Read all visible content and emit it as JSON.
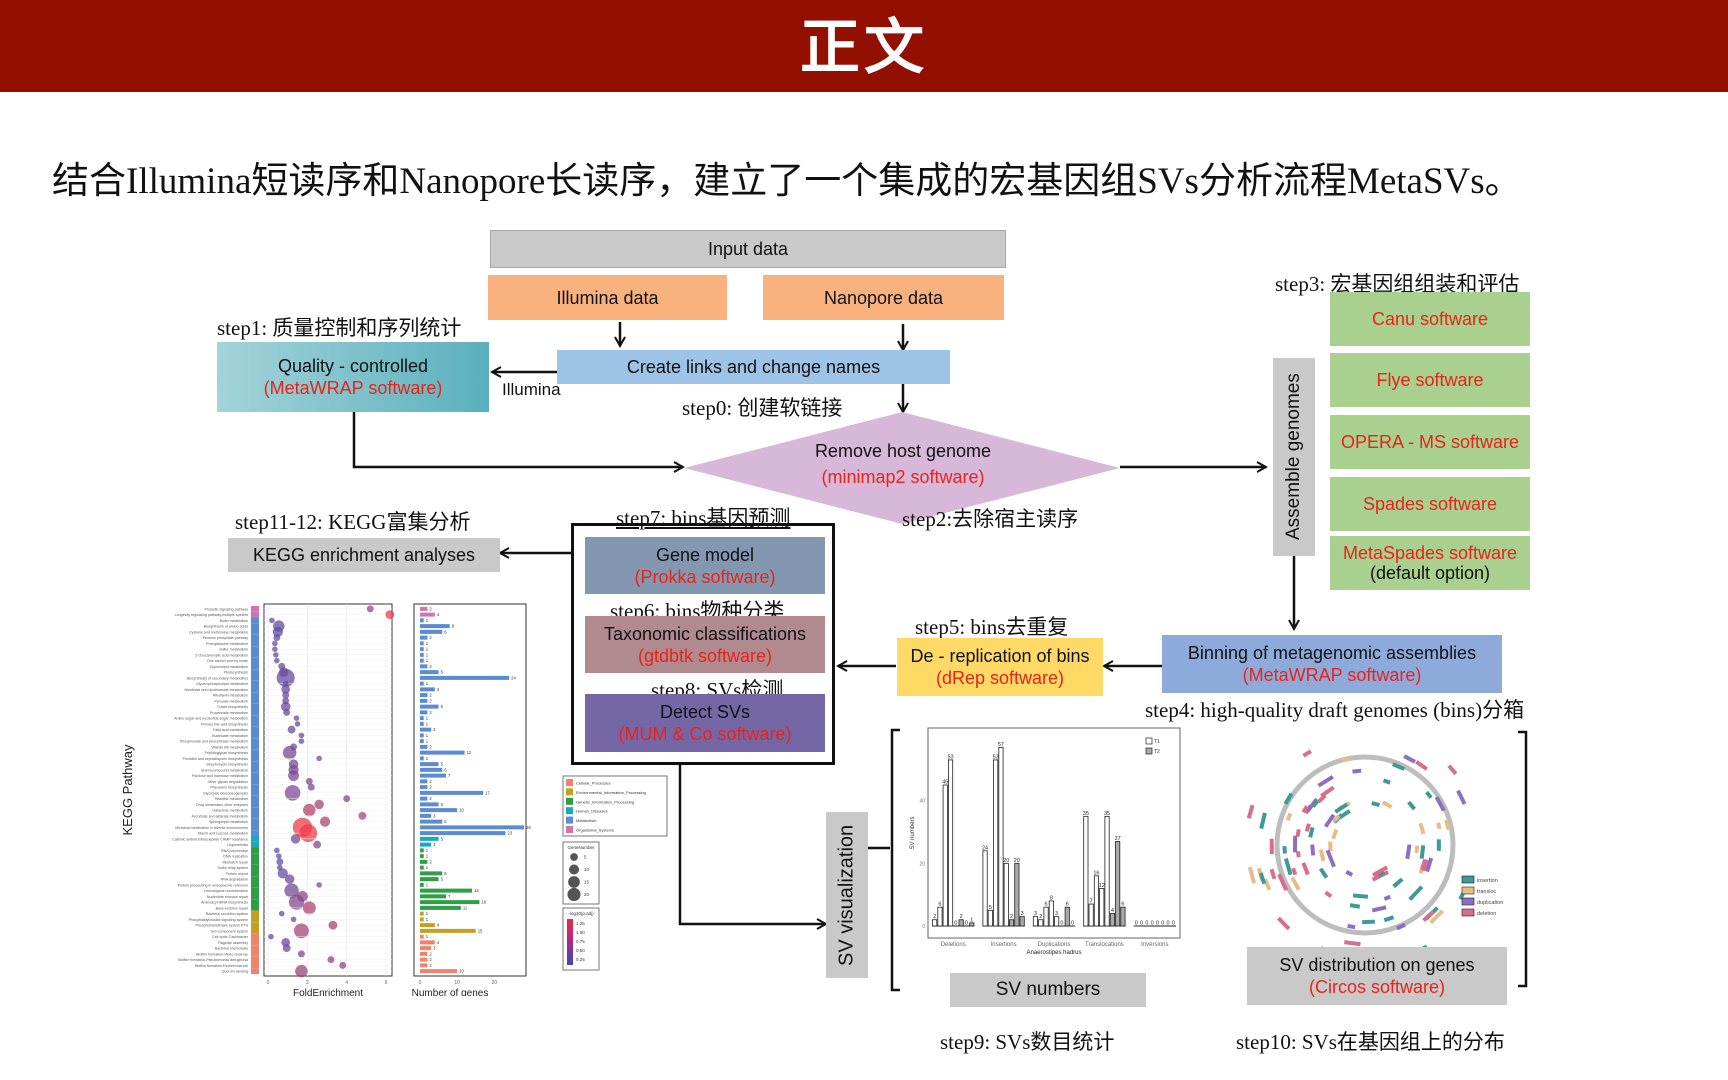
{
  "header": {
    "title": "正文"
  },
  "subtitle": "结合Illumina短读序和Nanopore长读序，建立了一个集成的宏基因组SVs分析流程MetaSVs。",
  "flow": {
    "input_data": "Input data",
    "illumina_data": "Illumina data",
    "nanopore_data": "Nanopore data",
    "create_links": "Create links and change names",
    "step0": "step0: 创建软链接",
    "illumina_label": "Illumina",
    "step1": "step1: 质量控制和序列统计",
    "quality": {
      "title": "Quality - controlled",
      "software": "(MetaWRAP software)"
    },
    "remove_host": {
      "title": "Remove host genome",
      "software": "(minimap2 software)"
    },
    "step2": "step2:去除宿主读序",
    "step3": "step3: 宏基因组组装和评估",
    "assemble": "Assemble genomes",
    "assemblers": [
      {
        "name": "Canu software",
        "note": ""
      },
      {
        "name": "Flye software",
        "note": ""
      },
      {
        "name": "OPERA - MS software",
        "note": ""
      },
      {
        "name": "Spades software",
        "note": ""
      },
      {
        "name": "MetaSpades software",
        "note": "(default option)"
      }
    ],
    "binning": {
      "title": "Binning of metagenomic assemblies",
      "software": "(MetaWRAP software)"
    },
    "step4": "step4: high-quality draft genomes (bins)分箱",
    "step5": "step5: bins去重复",
    "dereplication": {
      "title": "De - replication of bins",
      "software": "(dRep software)"
    },
    "step7": "step7: bins基因预测",
    "gene_model": {
      "title": "Gene model",
      "software": "(Prokka software)"
    },
    "step6": "step6: bins物种分类",
    "taxonomy": {
      "title": "Taxonomic classifications",
      "software": "(gtdbtk software)"
    },
    "step8": "step8: SVs检测",
    "detect_svs": {
      "title": "Detect SVs",
      "software": "(MUM & Co software)"
    },
    "step11_12": "step11-12: KEGG富集分析",
    "kegg_box": "KEGG enrichment analyses",
    "sv_visualization": "SV visualization",
    "sv_numbers_box": "SV numbers",
    "step9": "step9: SVs数目统计",
    "sv_distribution": {
      "title": "SV distribution on genes",
      "software": "(Circos software)"
    },
    "step10": "step10: SVs在基因组上的分布"
  },
  "colors": {
    "header_bg": "#930f00",
    "software_red": "#e8231b"
  },
  "chart_data": [
    {
      "type": "bar",
      "title": "",
      "xlabel": "Anaerostipes hadrus",
      "ylabel": "SV numbers",
      "ylim": [
        0,
        60
      ],
      "yticks": [
        0,
        20,
        40
      ],
      "categories": [
        "Deletions",
        "Insertions",
        "Duplications",
        "Translocations",
        "Inversions"
      ],
      "legend": {
        "entries": [
          "T1",
          "T2"
        ],
        "position": "top-right"
      },
      "groups": [
        {
          "category": "Deletions",
          "bars": [
            {
              "v": 2,
              "s": "T1"
            },
            {
              "v": 6,
              "s": "T1"
            },
            {
              "v": 45,
              "s": "T1"
            },
            {
              "v": 53,
              "s": "T1"
            },
            {
              "v": 0,
              "s": "T1"
            },
            {
              "v": 2,
              "s": "T2"
            },
            {
              "v": 0,
              "s": "T2"
            },
            {
              "v": 1,
              "s": "T2"
            }
          ]
        },
        {
          "category": "Insertions",
          "bars": [
            {
              "v": 24,
              "s": "T1"
            },
            {
              "v": 5,
              "s": "T1"
            },
            {
              "v": 53,
              "s": "T1"
            },
            {
              "v": 57,
              "s": "T1"
            },
            {
              "v": 20,
              "s": "T1"
            },
            {
              "v": 2,
              "s": "T2"
            },
            {
              "v": 20,
              "s": "T2"
            },
            {
              "v": 3,
              "s": "T2"
            }
          ]
        },
        {
          "category": "Duplications",
          "bars": [
            {
              "v": 3,
              "s": "T1"
            },
            {
              "v": 2,
              "s": "T1"
            },
            {
              "v": 6,
              "s": "T1"
            },
            {
              "v": 8,
              "s": "T1"
            },
            {
              "v": 3,
              "s": "T1"
            },
            {
              "v": 0,
              "s": "T2"
            },
            {
              "v": 6,
              "s": "T2"
            },
            {
              "v": 0,
              "s": "T2"
            }
          ]
        },
        {
          "category": "Translocations",
          "bars": [
            {
              "v": 35,
              "s": "T1"
            },
            {
              "v": 7,
              "s": "T1"
            },
            {
              "v": 16,
              "s": "T1"
            },
            {
              "v": 12,
              "s": "T1"
            },
            {
              "v": 35,
              "s": "T1"
            },
            {
              "v": 4,
              "s": "T2"
            },
            {
              "v": 27,
              "s": "T2"
            },
            {
              "v": 6,
              "s": "T2"
            }
          ]
        },
        {
          "category": "Inversions",
          "bars": [
            {
              "v": 0,
              "s": "T1"
            },
            {
              "v": 0,
              "s": "T1"
            },
            {
              "v": 0,
              "s": "T1"
            },
            {
              "v": 0,
              "s": "T1"
            },
            {
              "v": 0,
              "s": "T1"
            },
            {
              "v": 0,
              "s": "T2"
            },
            {
              "v": 0,
              "s": "T2"
            },
            {
              "v": 0,
              "s": "T2"
            }
          ]
        }
      ]
    },
    {
      "type": "scatter",
      "title": "",
      "ylabel": "KEGG Pathway",
      "xlabel": "FoldEnrichment",
      "xlim": [
        0,
        6
      ],
      "xticks": [
        0,
        2,
        4,
        6
      ],
      "bar_xlabel": "Number of genes",
      "bar_xticks": [
        0,
        10,
        20
      ],
      "bar_xlim": [
        0,
        28
      ],
      "class_legend": [
        {
          "name": "Cellular_Processes",
          "color": "#f0816a"
        },
        {
          "name": "Environmental_Information_Processing",
          "color": "#c4a021"
        },
        {
          "name": "Genetic_Information_Processing",
          "color": "#2e9e47"
        },
        {
          "name": "Human_Diseases",
          "color": "#1ca7bd"
        },
        {
          "name": "Metabolism",
          "color": "#5b8bd0"
        },
        {
          "name": "Organismal_Systems",
          "color": "#d074b0"
        }
      ],
      "size_legend": {
        "title": "GeneNumber",
        "values": [
          5,
          10,
          15,
          20
        ]
      },
      "color_legend": {
        "title": "-log10(p.adj)",
        "values": [
          1.25,
          1.0,
          0.75,
          0.5,
          0.25
        ]
      },
      "pathways": [
        {
          "name": "Prolactin signaling pathway",
          "cls": "Organismal_Systems",
          "fe": 5.2,
          "n": 2,
          "p": 0.6
        },
        {
          "name": "Longevity regulating pathway-multiple species",
          "cls": "Organismal_Systems",
          "fe": 6.2,
          "n": 4,
          "p": 1.2
        },
        {
          "name": "Biotin metabolism",
          "cls": "Metabolism",
          "fe": 0.2,
          "n": 1,
          "p": 0.2
        },
        {
          "name": "Biosynthesis of amino acids",
          "cls": "Metabolism",
          "fe": 0.55,
          "n": 8,
          "p": 0.2
        },
        {
          "name": "Cysteine and methionine metabolism",
          "cls": "Metabolism",
          "fe": 0.5,
          "n": 6,
          "p": 0.2
        },
        {
          "name": "Pentose phosphate pathway",
          "cls": "Metabolism",
          "fe": 0.45,
          "n": 2,
          "p": 0.2
        },
        {
          "name": "Phenylalanine metabolism",
          "cls": "Metabolism",
          "fe": 0.35,
          "n": 1,
          "p": 0.2
        },
        {
          "name": "Sulfur metabolism",
          "cls": "Metabolism",
          "fe": 0.35,
          "n": 1,
          "p": 0.2
        },
        {
          "name": "2-Oxocarboxylic acid metabolism",
          "cls": "Metabolism",
          "fe": 0.4,
          "n": 1,
          "p": 0.2
        },
        {
          "name": "One carbon pool by folate",
          "cls": "Metabolism",
          "fe": 0.45,
          "n": 1,
          "p": 0.2
        },
        {
          "name": "Glycerolipid metabolism",
          "cls": "Metabolism",
          "fe": 0.7,
          "n": 2,
          "p": 0.2
        },
        {
          "name": "Photosynthesis",
          "cls": "Metabolism",
          "fe": 0.8,
          "n": 5,
          "p": 0.2
        },
        {
          "name": "Biosynthesis of secondary metabolites",
          "cls": "Metabolism",
          "fe": 0.9,
          "n": 24,
          "p": 0.25
        },
        {
          "name": "Glycerophospholipid metabolism",
          "cls": "Metabolism",
          "fe": 0.9,
          "n": 1,
          "p": 0.2
        },
        {
          "name": "Nicotinate and nicotinamide metabolism",
          "cls": "Metabolism",
          "fe": 0.9,
          "n": 4,
          "p": 0.25
        },
        {
          "name": "Riboflavin metabolism",
          "cls": "Metabolism",
          "fe": 0.9,
          "n": 2,
          "p": 0.25
        },
        {
          "name": "Pyruvate metabolism",
          "cls": "Metabolism",
          "fe": 0.9,
          "n": 2,
          "p": 0.25
        },
        {
          "name": "Folate biosynthesis",
          "cls": "Metabolism",
          "fe": 0.9,
          "n": 5,
          "p": 0.25
        },
        {
          "name": "Propanoate metabolism",
          "cls": "Metabolism",
          "fe": 0.95,
          "n": 2,
          "p": 0.25
        },
        {
          "name": "Amino sugar and nucleotide sugar metabolism",
          "cls": "Metabolism",
          "fe": 1.45,
          "n": 1,
          "p": 0.3
        },
        {
          "name": "Primary bile acid biosynthesis",
          "cls": "Metabolism",
          "fe": 1.5,
          "n": 1,
          "p": 0.3
        },
        {
          "name": "Fatty acid metabolism",
          "cls": "Metabolism",
          "fe": 1.2,
          "n": 3,
          "p": 0.3
        },
        {
          "name": "Butanoate metabolism",
          "cls": "Metabolism",
          "fe": 1.7,
          "n": 1,
          "p": 0.3
        },
        {
          "name": "Phosphonate and phosphinate metabolism",
          "cls": "Metabolism",
          "fe": 1.7,
          "n": 1,
          "p": 0.3
        },
        {
          "name": "Vitamin B6 metabolism",
          "cls": "Metabolism",
          "fe": 1.3,
          "n": 2,
          "p": 0.3
        },
        {
          "name": "Peptidoglycan biosynthesis",
          "cls": "Metabolism",
          "fe": 1.1,
          "n": 12,
          "p": 0.35
        },
        {
          "name": "Penicillin and cephalosporin biosynthesis",
          "cls": "Metabolism",
          "fe": 2.6,
          "n": 1,
          "p": 0.4
        },
        {
          "name": "Streptomycin biosynthesis",
          "cls": "Metabolism",
          "fe": 1.3,
          "n": 5,
          "p": 0.35
        },
        {
          "name": "Selenocompound metabolism",
          "cls": "Metabolism",
          "fe": 1.3,
          "n": 6,
          "p": 0.35
        },
        {
          "name": "Fructose and mannose metabolism",
          "cls": "Metabolism",
          "fe": 1.3,
          "n": 7,
          "p": 0.35
        },
        {
          "name": "Other glycan degradation",
          "cls": "Metabolism",
          "fe": 2.1,
          "n": 2,
          "p": 0.4
        },
        {
          "name": "Phenazine biosynthesis",
          "cls": "Metabolism",
          "fe": 2.2,
          "n": 2,
          "p": 0.4
        },
        {
          "name": "Glycolysis Gluconeogenesis",
          "cls": "Metabolism",
          "fe": 1.25,
          "n": 17,
          "p": 0.4
        },
        {
          "name": "Histidine metabolism",
          "cls": "Metabolism",
          "fe": 4.0,
          "n": 2,
          "p": 0.5
        },
        {
          "name": "Drug metabolism-other enzymes",
          "cls": "Metabolism",
          "fe": 2.6,
          "n": 5,
          "p": 0.7
        },
        {
          "name": "Galactose metabolism",
          "cls": "Metabolism",
          "fe": 2.1,
          "n": 10,
          "p": 0.8
        },
        {
          "name": "Ascorbate and aldarate metabolism",
          "cls": "Metabolism",
          "fe": 4.8,
          "n": 3,
          "p": 0.7
        },
        {
          "name": "Sphingolipid metabolism",
          "cls": "Metabolism",
          "fe": 2.9,
          "n": 6,
          "p": 0.8
        },
        {
          "name": "Microbial metabolism in diverse environments",
          "cls": "Metabolism",
          "fe": 1.75,
          "n": 28,
          "p": 1.2
        },
        {
          "name": "Starch and sucrose metabolism",
          "cls": "Metabolism",
          "fe": 2.05,
          "n": 23,
          "p": 1.25
        },
        {
          "name": "Cationic antimicrobial peptide CAMP resistance",
          "cls": "Human_Diseases",
          "fe": 1.4,
          "n": 5,
          "p": 0.35
        },
        {
          "name": "Legionellosis",
          "cls": "Human_Diseases",
          "fe": 2.5,
          "n": 3,
          "p": 0.5
        },
        {
          "name": "RNA polymerase",
          "cls": "Genetic_Information_Processing",
          "fe": 0.45,
          "n": 1,
          "p": 0.2
        },
        {
          "name": "DNA replication",
          "cls": "Genetic_Information_Processing",
          "fe": 0.55,
          "n": 1,
          "p": 0.2
        },
        {
          "name": "Mismatch repair",
          "cls": "Genetic_Information_Processing",
          "fe": 0.6,
          "n": 2,
          "p": 0.2
        },
        {
          "name": "Sulfur relay system",
          "cls": "Genetic_Information_Processing",
          "fe": 0.6,
          "n": 1,
          "p": 0.2
        },
        {
          "name": "Protein export",
          "cls": "Genetic_Information_Processing",
          "fe": 0.75,
          "n": 6,
          "p": 0.2
        },
        {
          "name": "RNA degradation",
          "cls": "Genetic_Information_Processing",
          "fe": 1.1,
          "n": 5,
          "p": 0.3
        },
        {
          "name": "Protein processing in endoplasmic reticulum",
          "cls": "Genetic_Information_Processing",
          "fe": 2.6,
          "n": 1,
          "p": 0.4
        },
        {
          "name": "Homologous recombination",
          "cls": "Genetic_Information_Processing",
          "fe": 1.2,
          "n": 14,
          "p": 0.35
        },
        {
          "name": "Nucleotide excision repair",
          "cls": "Genetic_Information_Processing",
          "fe": 1.75,
          "n": 7,
          "p": 0.5
        },
        {
          "name": "Aminoacyl-tRNA biosynthesis",
          "cls": "Genetic_Information_Processing",
          "fe": 1.45,
          "n": 16,
          "p": 0.45
        },
        {
          "name": "Base excision repair",
          "cls": "Genetic_Information_Processing",
          "fe": 2.1,
          "n": 11,
          "p": 0.8
        },
        {
          "name": "Bacterial secretion system",
          "cls": "Environmental_Information_Processing",
          "fe": 0.7,
          "n": 1,
          "p": 0.2
        },
        {
          "name": "Phosphatidylinositol signaling system",
          "cls": "Environmental_Information_Processing",
          "fe": 1.3,
          "n": 1,
          "p": 0.3
        },
        {
          "name": "Phosphotransferase system PTS",
          "cls": "Environmental_Information_Processing",
          "fe": 3.3,
          "n": 4,
          "p": 0.7
        },
        {
          "name": "Two-component system",
          "cls": "Environmental_Information_Processing",
          "fe": 1.7,
          "n": 15,
          "p": 0.7
        },
        {
          "name": "Cell cycle-Caulobacter",
          "cls": "Cellular_Processes",
          "fe": 0.15,
          "n": 1,
          "p": 0.2
        },
        {
          "name": "Flagellar assembly",
          "cls": "Cellular_Processes",
          "fe": 0.9,
          "n": 4,
          "p": 0.25
        },
        {
          "name": "Bacterial chemotaxis",
          "cls": "Cellular_Processes",
          "fe": 0.95,
          "n": 3,
          "p": 0.25
        },
        {
          "name": "Biofilm formation-Vibrio cholerae",
          "cls": "Cellular_Processes",
          "fe": 1.7,
          "n": 2,
          "p": 0.4
        },
        {
          "name": "Biofilm formation-Pseudomonas aeruginosa",
          "cls": "Cellular_Processes",
          "fe": 3.2,
          "n": 2,
          "p": 0.5
        },
        {
          "name": "Biofilm formation-Escherichia coli",
          "cls": "Cellular_Processes",
          "fe": 3.8,
          "n": 2,
          "p": 0.5
        },
        {
          "name": "Quorum sensing",
          "cls": "Cellular_Processes",
          "fe": 1.7,
          "n": 10,
          "p": 0.6
        }
      ]
    },
    {
      "type": "circos",
      "legend": [
        {
          "name": "insertion",
          "color": "#3e9a96"
        },
        {
          "name": "transloc",
          "color": "#e6bd88"
        },
        {
          "name": "duplication",
          "color": "#8a6fc4"
        },
        {
          "name": "deletion",
          "color": "#d96d8b"
        }
      ]
    }
  ]
}
